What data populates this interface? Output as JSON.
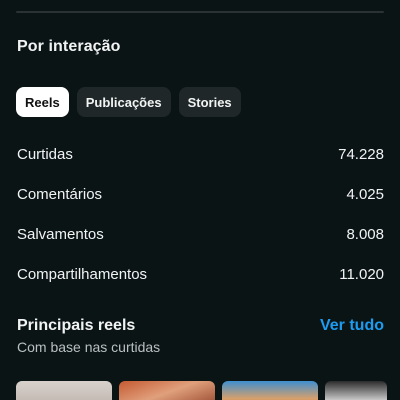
{
  "section": {
    "title": "Por interação"
  },
  "tabs": [
    {
      "label": "Reels",
      "active": true
    },
    {
      "label": "Publicações",
      "active": false
    },
    {
      "label": "Stories",
      "active": false
    }
  ],
  "metrics": [
    {
      "label": "Curtidas",
      "value": "74.228"
    },
    {
      "label": "Comentários",
      "value": "4.025"
    },
    {
      "label": "Salvamentos",
      "value": "8.008"
    },
    {
      "label": "Compartilhamentos",
      "value": "11.020"
    }
  ],
  "top_reels": {
    "title": "Principais reels",
    "see_all_label": "Ver tudo",
    "subtitle": "Com base nas curtidas"
  },
  "colors": {
    "background": "#0b1415",
    "accent": "#1d9bf0",
    "chip_inactive": "#1f2729",
    "chip_active": "#ffffff"
  }
}
